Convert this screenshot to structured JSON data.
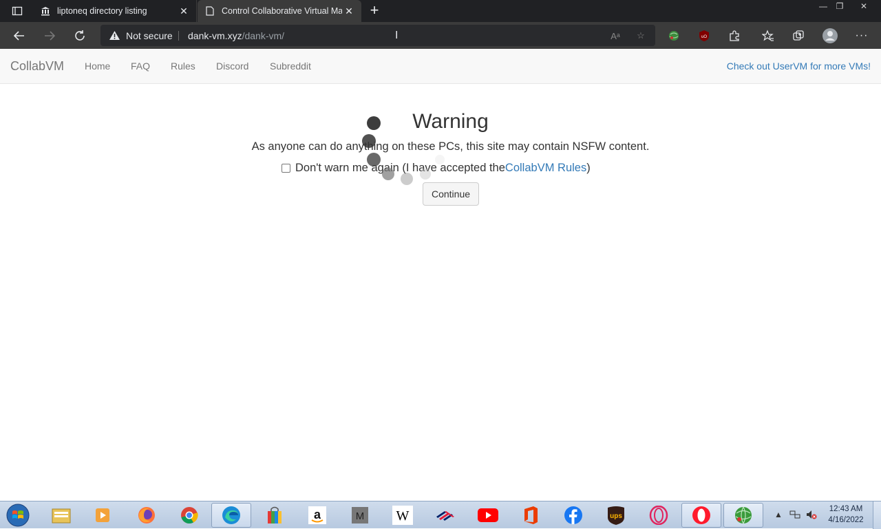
{
  "browser": {
    "tabs": [
      {
        "title": "liptoneq directory listing",
        "icon": "bank-icon"
      },
      {
        "title": "Control Collaborative Virtual Ma",
        "icon": "page-icon"
      }
    ],
    "address": {
      "security_label": "Not secure",
      "host": "dank-vm.xyz",
      "path": "/dank-vm/"
    }
  },
  "navbar": {
    "brand": "CollabVM",
    "links": [
      "Home",
      "FAQ",
      "Rules",
      "Discord",
      "Subreddit"
    ],
    "right_link": "Check out UserVM for more VMs!"
  },
  "warning": {
    "title": "Warning",
    "text": "As anyone can do anything on these PCs, this site may contain NSFW content.",
    "checkbox_prefix": "Don't warn me again (I have accepted the ",
    "checkbox_link": "CollabVM Rules",
    "checkbox_suffix": ")",
    "continue_label": "Continue"
  },
  "taskbar": {
    "apps": [
      "explorer",
      "media-player",
      "firefox",
      "chrome",
      "edge",
      "store",
      "amazon",
      "m-app",
      "wikipedia",
      "bank-of-america",
      "youtube",
      "office",
      "facebook",
      "ups",
      "opera-gx",
      "opera",
      "network-globe"
    ],
    "time": "12:43 AM",
    "date": "4/16/2022"
  },
  "colors": {
    "link": "#337ab7",
    "navbar_bg": "#f8f8f8",
    "chrome_dark": "#202124"
  }
}
